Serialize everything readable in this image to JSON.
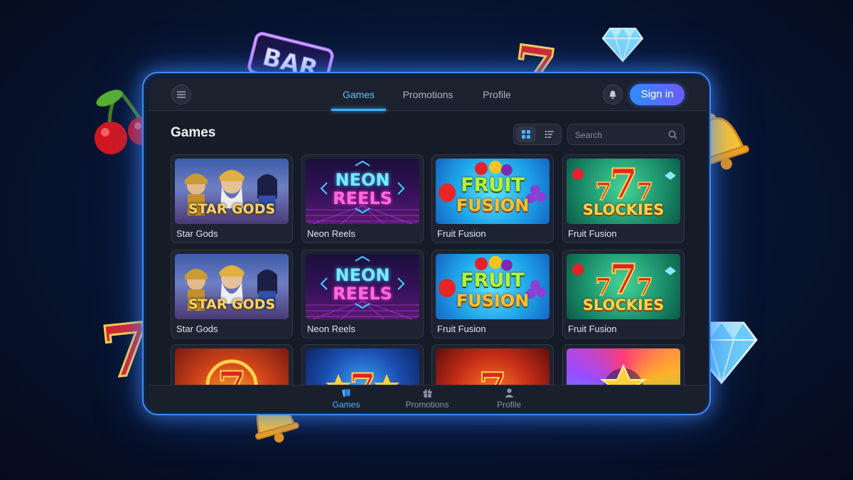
{
  "topbar": {
    "menu_icon": "hamburger-icon",
    "tabs": [
      {
        "label": "Games",
        "active": true
      },
      {
        "label": "Promotions",
        "active": false
      },
      {
        "label": "Profile",
        "active": false
      }
    ],
    "notification_icon": "bell-icon",
    "signin_label": "Sign in"
  },
  "section": {
    "title": "Games",
    "view_modes": [
      "grid-icon",
      "list-icon"
    ],
    "active_view": "grid",
    "search_placeholder": "Search"
  },
  "games": [
    {
      "label": "Star Gods",
      "art_text": [
        "STAR GODS"
      ]
    },
    {
      "label": "Neon Reels",
      "art_text": [
        "NEON",
        "REELS"
      ]
    },
    {
      "label": "Fruit Fusion",
      "art_text": [
        "FRUIT",
        "FUSION"
      ]
    },
    {
      "label": "Fruit Fusion",
      "art_text": [
        "SLOCKIES"
      ]
    },
    {
      "label": "Star Gods",
      "art_text": [
        "STAR GODS"
      ]
    },
    {
      "label": "Neon Reels",
      "art_text": [
        "NEON",
        "REELS"
      ]
    },
    {
      "label": "Fruit Fusion",
      "art_text": [
        "FRUIT",
        "FUSION"
      ]
    },
    {
      "label": "Fruit Fusion",
      "art_text": [
        "SLOCKIES"
      ]
    }
  ],
  "partial_row_art": [
    "7",
    "7",
    "7",
    "star"
  ],
  "bottom_nav": [
    {
      "label": "Games",
      "icon": "cards-icon",
      "active": true
    },
    {
      "label": "Promotions",
      "icon": "gift-icon",
      "active": false
    },
    {
      "label": "Profile",
      "icon": "user-icon",
      "active": false
    }
  ],
  "decorations": {
    "bar_sign": "BAR",
    "seven": "7",
    "items": [
      "cherry-icon",
      "bar-sign",
      "seven-icon",
      "diamond-icon",
      "bell-icon"
    ]
  },
  "colors": {
    "accent": "#43b0ff",
    "signin_gradient_start": "#2f8cff",
    "signin_gradient_end": "#6c5bff",
    "frame_glow": "#3d8bff"
  }
}
